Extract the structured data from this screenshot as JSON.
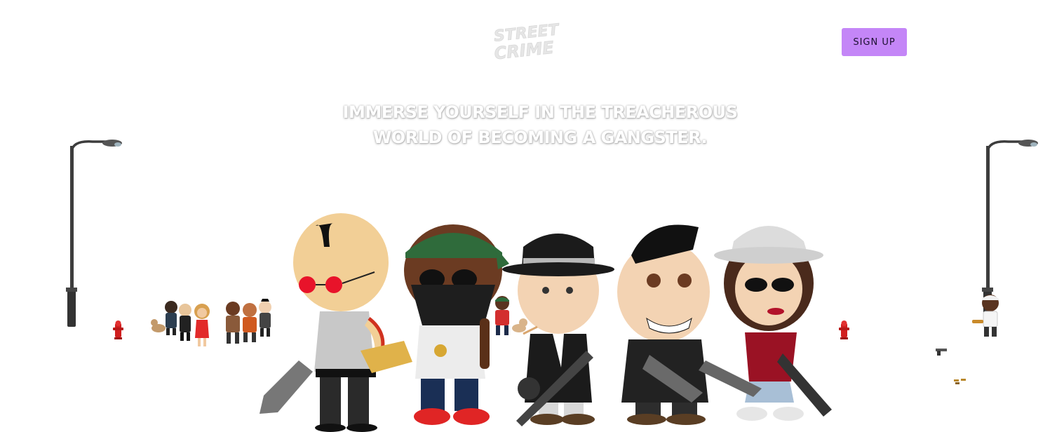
{
  "header": {
    "logo_text": [
      "STREET",
      "CRIME"
    ],
    "signup_label": "SIGN UP"
  },
  "hero": {
    "tagline_line1": "IMMERSE YOURSELF IN THE TREACHEROUS",
    "tagline_line2": "WORLD OF BECOMING A GANGSTER."
  },
  "colors": {
    "signup_bg": "#c486f7",
    "signup_text": "#1b1030",
    "background": "#ffffff",
    "logo": "#e4e4e4",
    "hydrant": "#d11f1f",
    "lamp": "#3d3d3d"
  },
  "scene": {
    "characters": [
      "bald-gangster-red-glasses",
      "bandana-gangster-gold-gun",
      "fedora-gangster-tommy-gun",
      "pompadour-gangster",
      "woman-gangster-white-hat"
    ],
    "icons": [
      "street-lamp-icon",
      "fire-hydrant-icon",
      "pistol-icon",
      "bullets-icon"
    ]
  }
}
